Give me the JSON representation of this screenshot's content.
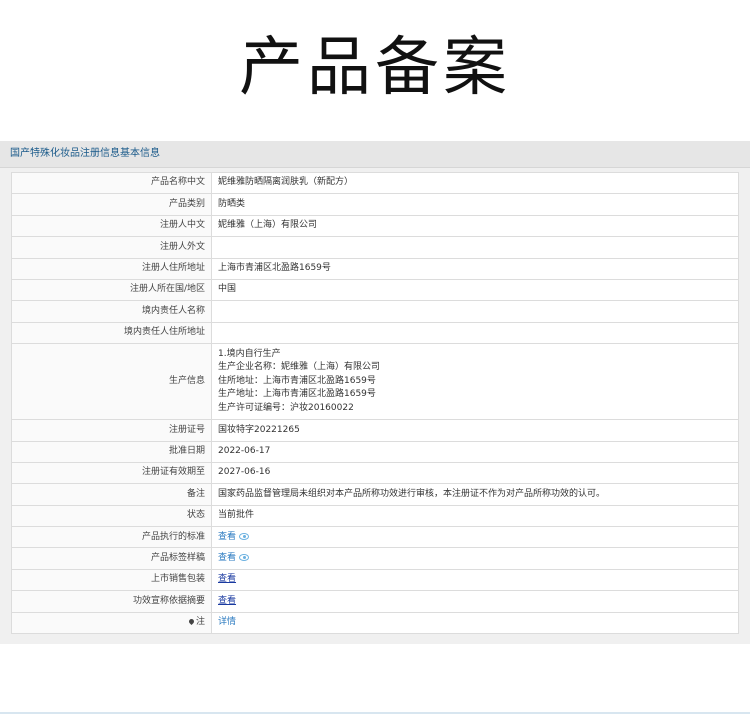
{
  "page": {
    "title": "产品备案"
  },
  "panel": {
    "header": "国产特殊化妆品注册信息基本信息"
  },
  "rows": [
    {
      "label": "产品名称中文",
      "value": "妮维雅防晒隔离润肤乳（新配方）"
    },
    {
      "label": "产品类别",
      "value": "防晒类"
    },
    {
      "label": "注册人中文",
      "value": "妮维雅（上海）有限公司"
    },
    {
      "label": "注册人外文",
      "value": ""
    },
    {
      "label": "注册人住所地址",
      "value": "上海市青浦区北盈路1659号"
    },
    {
      "label": "注册人所在国/地区",
      "value": "中国"
    },
    {
      "label": "境内责任人名称",
      "value": ""
    },
    {
      "label": "境内责任人住所地址",
      "value": ""
    }
  ],
  "production": {
    "label": "生产信息",
    "lines": [
      "1.境内自行生产",
      "生产企业名称：妮维雅（上海）有限公司",
      "住所地址：上海市青浦区北盈路1659号",
      "生产地址：上海市青浦区北盈路1659号",
      "生产许可证编号：沪妆20160022"
    ]
  },
  "rows2": [
    {
      "label": "注册证号",
      "value": "国妆特字20221265"
    },
    {
      "label": "批准日期",
      "value": "2022-06-17"
    },
    {
      "label": "注册证有效期至",
      "value": "2027-06-16"
    },
    {
      "label": "备注",
      "value": "国家药品监督管理局未组织对本产品所称功效进行审核，本注册证不作为对产品所称功效的认可。"
    },
    {
      "label": "状态",
      "value": "当前批件"
    }
  ],
  "links": {
    "standard": {
      "label": "产品执行的标准",
      "text": "查看"
    },
    "sample": {
      "label": "产品标签样稿",
      "text": "查看"
    },
    "package": {
      "label": "上市销售包装",
      "text": "查看"
    },
    "efficacy": {
      "label": "功效宣称依据摘要",
      "text": "查看"
    },
    "note": {
      "label": "注",
      "text": "详情"
    }
  },
  "colors": {
    "link": "#2a7ac0",
    "header_text": "#1a5a8a",
    "border": "#dcdcdc"
  }
}
